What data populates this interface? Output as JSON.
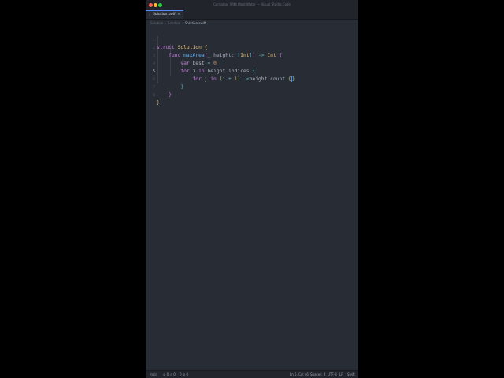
{
  "window": {
    "title": "Container With Most Water — Visual Studio Code"
  },
  "tabs": [
    {
      "label": "Solution.swift",
      "close": "×",
      "icon": "swift-icon"
    }
  ],
  "breadcrumb": {
    "items": [
      "Solution",
      "Solution",
      "Solution.swift"
    ],
    "separator": "›"
  },
  "editor": {
    "line_numbers": [
      "1",
      "2",
      "3",
      "4",
      "5",
      "6",
      "7",
      "8"
    ],
    "active_line": "5",
    "lines": [
      [
        "struct",
        "Solution",
        "{"
      ],
      [
        "func",
        "maxArea",
        "(",
        "_",
        "height",
        ":",
        "[",
        "Int",
        "]",
        ")",
        "->",
        "Int",
        "{"
      ],
      [
        "var",
        "best",
        "=",
        "0"
      ],
      [
        "for",
        "i",
        "in",
        "height",
        ".",
        "indices",
        "{"
      ],
      [
        "for",
        "j",
        "in",
        "(",
        "i",
        "+",
        "1",
        ")",
        "..<",
        "height",
        ".",
        "count",
        "{",
        "}"
      ],
      [
        "}"
      ],
      [
        "}"
      ],
      [
        "}"
      ]
    ]
  },
  "statusbar": {
    "left": [
      "main",
      "⊘ 0 ⚠ 0",
      "0 ⊘ 0"
    ],
    "right": [
      "Ln 5, Col 46",
      "Spaces: 4",
      "UTF-8",
      "LF",
      "Swift"
    ]
  },
  "colors": {
    "accent": "#528bff",
    "keyword": "#c678dd",
    "type": "#e5c07b",
    "function": "#61afef",
    "number": "#d19a66"
  }
}
